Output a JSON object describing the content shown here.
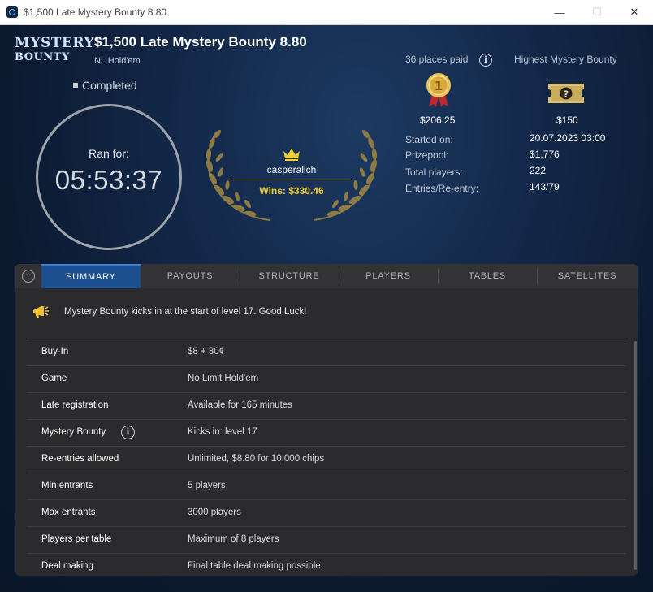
{
  "window": {
    "title": "$1,500 Late Mystery Bounty 8.80",
    "minimize": "—",
    "maximize": "☐",
    "close": "✕"
  },
  "logo": {
    "line1": "MYSTERY",
    "line2": "BOUNTY"
  },
  "tournament": {
    "name": "$1,500 Late Mystery Bounty 8.80",
    "game_type": "NL Hold'em",
    "status": "Completed"
  },
  "timer": {
    "label": "Ran for:",
    "value": "05:53:37"
  },
  "winner": {
    "name": "casperalich",
    "wins": "Wins: $330.46"
  },
  "prizes": {
    "places_paid": "36 places paid",
    "highest_label": "Highest Mystery Bounty",
    "first_prize": "$206.25",
    "top_bounty": "$150"
  },
  "details": [
    {
      "label": "Started on:",
      "value": "20.07.2023   03:00"
    },
    {
      "label": "Prizepool:",
      "value": "$1,776"
    },
    {
      "label": "Total players:",
      "value": "222"
    },
    {
      "label": "Entries/Re-entry:",
      "value": "143/79"
    }
  ],
  "tabs": [
    "SUMMARY",
    "PAYOUTS",
    "STRUCTURE",
    "PLAYERS",
    "TABLES",
    "SATELLITES"
  ],
  "announcement": "Mystery Bounty kicks in at the start of level 17. Good Luck!",
  "summary": [
    {
      "key": "Buy-In",
      "value": "$8 + 80¢"
    },
    {
      "key": "Game",
      "value": "No Limit Hold'em"
    },
    {
      "key": "Late registration",
      "value": "Available for 165 minutes"
    },
    {
      "key": "Mystery Bounty",
      "value": "Kicks in: level 17"
    },
    {
      "key": "Re-entries allowed",
      "value": "Unlimited, $8.80 for 10,000 chips"
    },
    {
      "key": "Min entrants",
      "value": "5 players"
    },
    {
      "key": "Max entrants",
      "value": "3000 players"
    },
    {
      "key": "Players per table",
      "value": "Maximum of 8 players"
    },
    {
      "key": "Deal making",
      "value": "Final table deal making possible"
    }
  ],
  "colors": {
    "accent": "#1b4f8f",
    "gold": "#f2d033",
    "panel": "#2b2b2d",
    "background": "#0d1b2e"
  },
  "icons": {
    "info": "i",
    "collapse": "⌃"
  }
}
